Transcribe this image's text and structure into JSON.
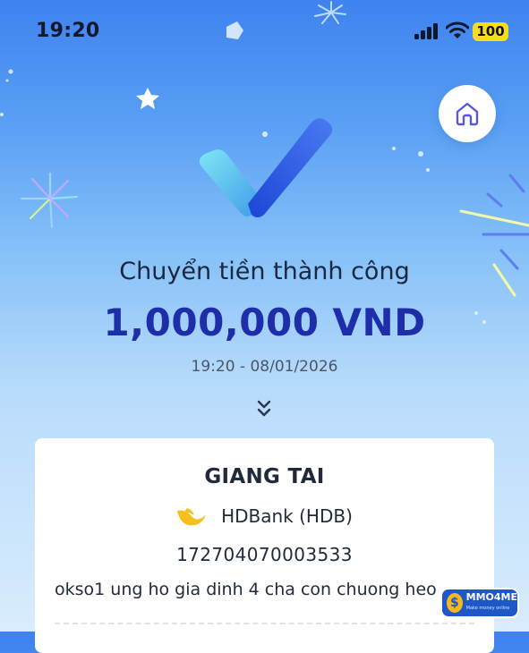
{
  "status_bar": {
    "time": "19:20",
    "battery": "100"
  },
  "result": {
    "title": "Chuyển tiền thành công",
    "amount": "1,000,000 VND",
    "datetime": "19:20 - 08/01/2026"
  },
  "recipient": {
    "name": "GIANG TAI",
    "bank": "HDBank (HDB)",
    "account_number": "172704070003533",
    "note": "okso1  ung ho gia dinh 4 cha con chuong heo"
  },
  "watermark": {
    "brand": "MMO4ME",
    "tagline": "Make money online"
  },
  "colors": {
    "amount": "#1d2ea8",
    "battery": "#f5dc21",
    "bank_logo": "#f6c01a"
  }
}
